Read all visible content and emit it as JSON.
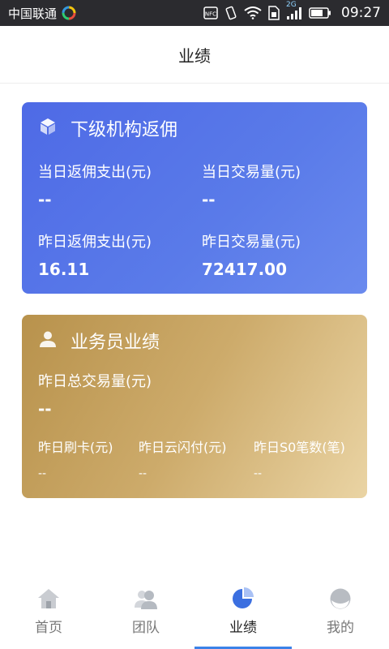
{
  "status_bar": {
    "carrier": "中国联通",
    "network": "2G",
    "time": "09:27"
  },
  "header": {
    "title": "业绩"
  },
  "sub_agency_card": {
    "title": "下级机构返佣",
    "icon": "cube-icon",
    "today_rebate_label": "当日返佣支出(元)",
    "today_rebate_value": "--",
    "today_volume_label": "当日交易量(元)",
    "today_volume_value": "--",
    "yesterday_rebate_label": "昨日返佣支出(元)",
    "yesterday_rebate_value": "16.11",
    "yesterday_volume_label": "昨日交易量(元)",
    "yesterday_volume_value": "72417.00"
  },
  "salesperson_card": {
    "title": "业务员业绩",
    "icon": "person-icon",
    "total_volume_label": "昨日总交易量(元)",
    "total_volume_value": "--",
    "card_swipe_label": "昨日刷卡(元)",
    "card_swipe_value": "--",
    "quickpass_label": "昨日云闪付(元)",
    "quickpass_value": "--",
    "s0_count_label": "昨日S0笔数(笔)",
    "s0_count_value": "--"
  },
  "bottom_nav": {
    "items": [
      {
        "label": "首页",
        "icon": "home-icon"
      },
      {
        "label": "团队",
        "icon": "team-icon"
      },
      {
        "label": "业绩",
        "icon": "pie-chart-icon",
        "active": true
      },
      {
        "label": "我的",
        "icon": "profile-icon"
      }
    ]
  },
  "colors": {
    "accent": "#3b82e8",
    "blue_card": "#5271e7",
    "gold_card": "#c9a866"
  }
}
